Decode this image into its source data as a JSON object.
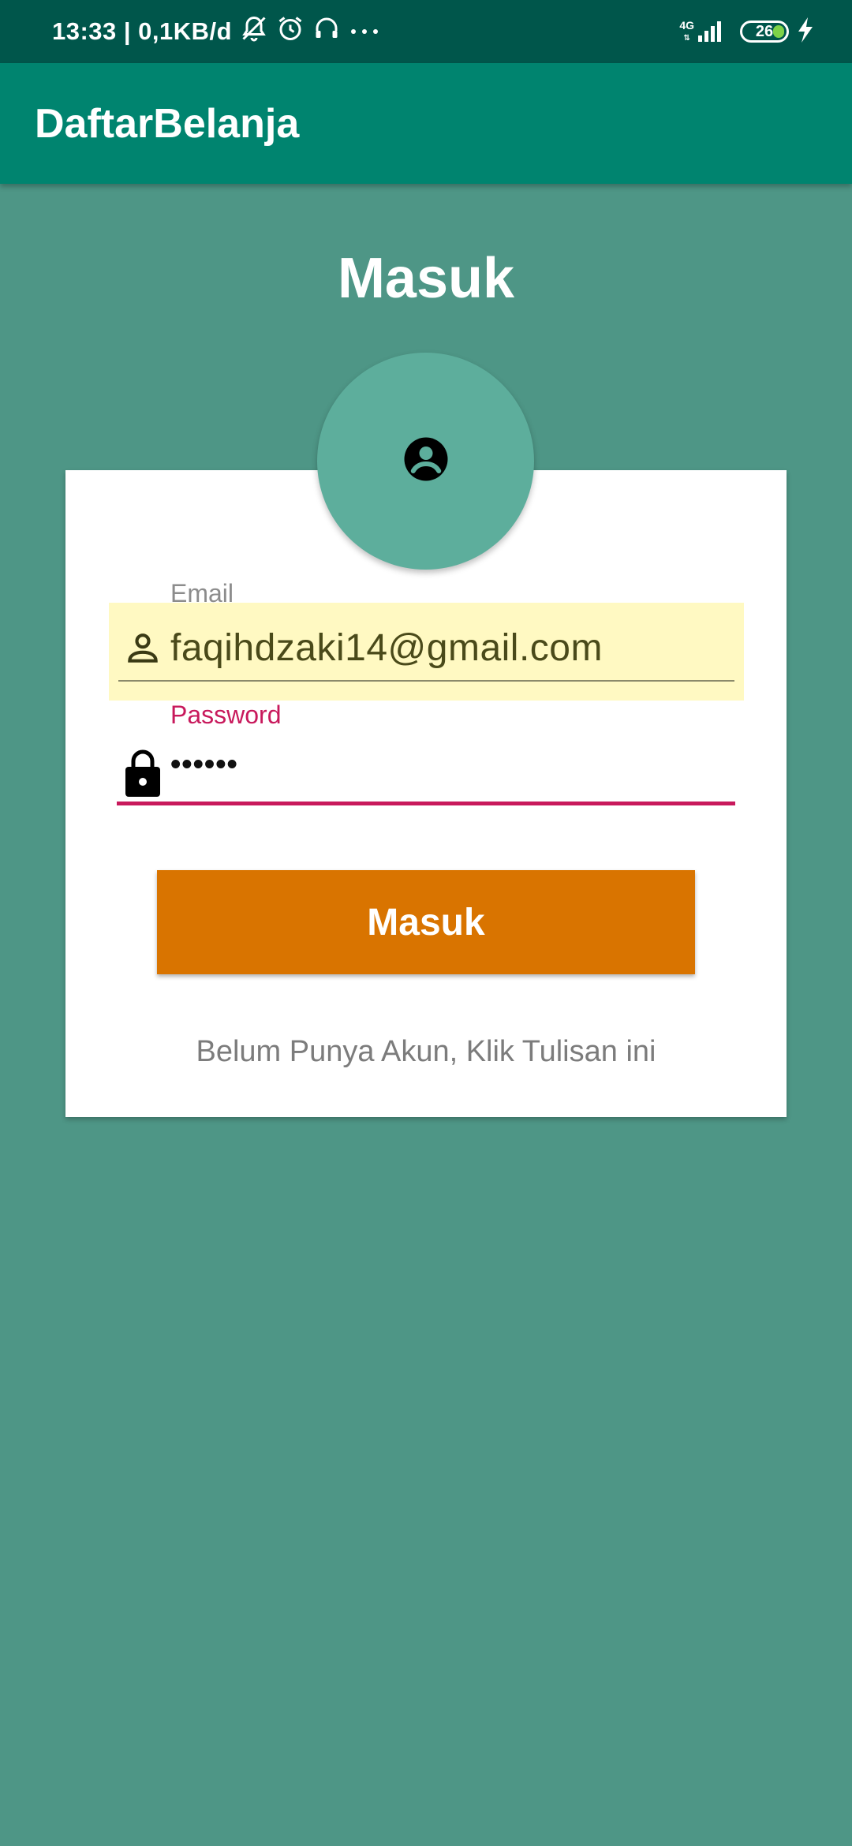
{
  "status_bar": {
    "time_text": "13:33 | 0,1KB/d",
    "network": "4G",
    "battery": "26",
    "icons": [
      "mute-notification-icon",
      "alarm-icon",
      "headset-icon",
      "more-dots-icon",
      "signal-icon",
      "charging-icon"
    ]
  },
  "app_bar": {
    "title": "DaftarBelanja"
  },
  "page": {
    "heading": "Masuk"
  },
  "form": {
    "email_label": "Email",
    "email_value": "faqihdzaki14@gmail.com",
    "password_label": "Password",
    "password_value": "••••••",
    "submit_label": "Masuk",
    "register_text": "Belum Punya Akun, Klik Tulisan ini"
  },
  "colors": {
    "background": "#4e9686",
    "status_bar": "#00564b",
    "app_bar": "#00846f",
    "avatar": "#5dae9c",
    "email_field_bg": "#fff9c2",
    "accent": "#c8195c",
    "button": "#d97400"
  }
}
